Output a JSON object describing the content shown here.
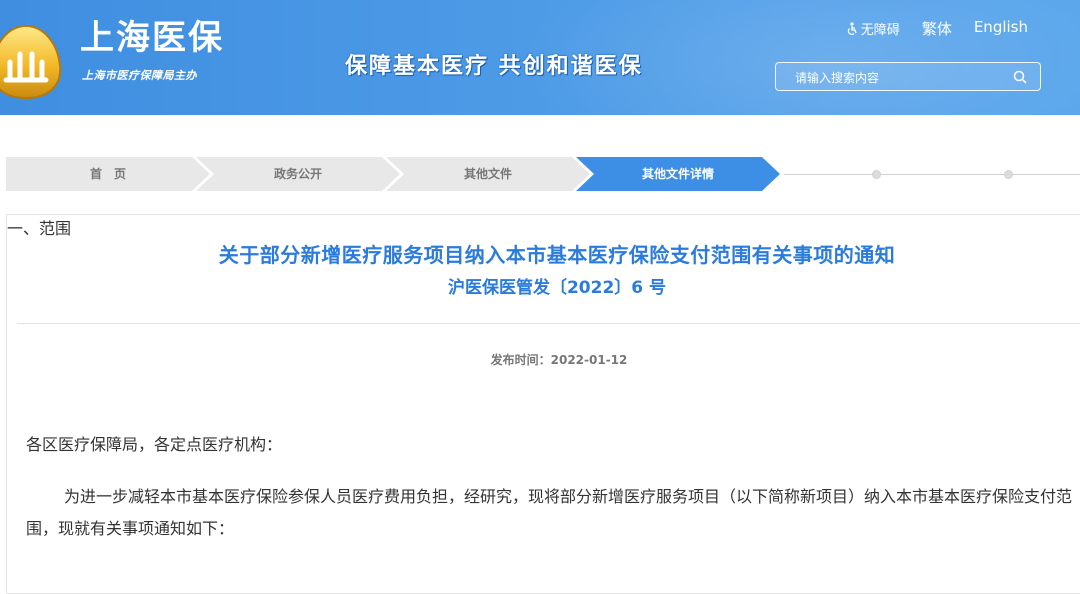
{
  "header": {
    "logo_title": "上海医保",
    "logo_subtitle": "上海市医疗保障局主办",
    "slogan": "保障基本医疗  共创和谐医保",
    "accessibility_label": "无障碍",
    "traditional_label": "繁体",
    "english_label": "English",
    "search_placeholder": "请输入搜索内容",
    "accent_color": "#4a97e4"
  },
  "breadcrumb": {
    "items": [
      {
        "label": "首　页"
      },
      {
        "label": "政务公开"
      },
      {
        "label": "其他文件"
      },
      {
        "label": "其他文件详情"
      }
    ]
  },
  "article": {
    "title": "关于部分新增医疗服务项目纳入本市基本医疗保险支付范围有关事项的通知",
    "doc_number": "沪医保医管发〔2022〕6 号",
    "publish_label": "发布时间：",
    "publish_date": "2022-01-12",
    "addressee": "各区医疗保障局，各定点医疗机构：",
    "body": "为进一步减轻本市基本医疗保险参保人员医疗费用负担，经研究，现将部分新增医疗服务项目（以下简称新项目）纳入本市基本医疗保险支付范围，现就有关事项通知如下：",
    "next_line": "一、范围",
    "title_color": "#2a7bdc"
  }
}
